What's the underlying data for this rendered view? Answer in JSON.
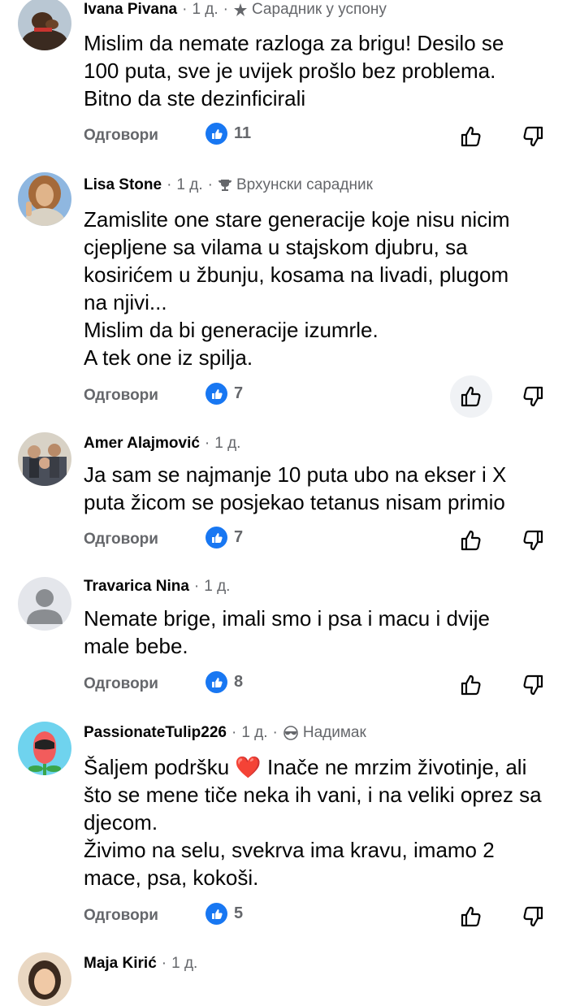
{
  "reply_label": "Одговори",
  "comments": [
    {
      "author": "Ivana Pivana",
      "time": "1 д.",
      "badge": "Сарадник у успону",
      "badge_icon": "rising-star-icon",
      "lines": [
        "Mislim da nemate razloga za brigu! Desilo se",
        "100 puta, sve je uvijek prošlo bez problema.",
        "Bitno da ste dezinficirali"
      ],
      "likes": "11"
    },
    {
      "author": "Lisa Stone",
      "time": "1 д.",
      "badge": "Врхунски сарадник",
      "badge_icon": "trophy-icon",
      "lines": [
        "Zamislite one stare generacije koje nisu nicim",
        "cjepljene sa vilama u stajskom djubru, sa",
        "kosirićem u žbunju, kosama na livadi, plugom",
        "na njivi...",
        "Mislim da bi generacije izumrle.",
        "A tek one iz spilja."
      ],
      "likes": "7"
    },
    {
      "author": "Amer Alajmović",
      "time": "1 д.",
      "lines": [
        "Ja sam se najmanje 10 puta ubo na ekser i X",
        "puta žicom se posjekao tetanus nisam primio"
      ],
      "likes": "7"
    },
    {
      "author": "Travarica Nina",
      "time": "1 д.",
      "lines": [
        "Nemate brige, imali smo i psa i macu i dvije",
        "male bebe."
      ],
      "likes": "8"
    },
    {
      "author": "PassionateTulip226",
      "time": "1 д.",
      "badge": "Надимак",
      "badge_icon": "sunglasses-icon",
      "lines": [
        "Šaljem podršku ❤️ Inače ne mrzim životinje, ali",
        "što se mene tiče neka ih vani, i na veliki oprez sa",
        "djecom.",
        "Živimo na selu, svekrva ima kravu, imamo 2",
        "mace, psa, kokoši."
      ],
      "likes": "5"
    },
    {
      "author": "Maja Kirić",
      "time": "1 д."
    }
  ]
}
